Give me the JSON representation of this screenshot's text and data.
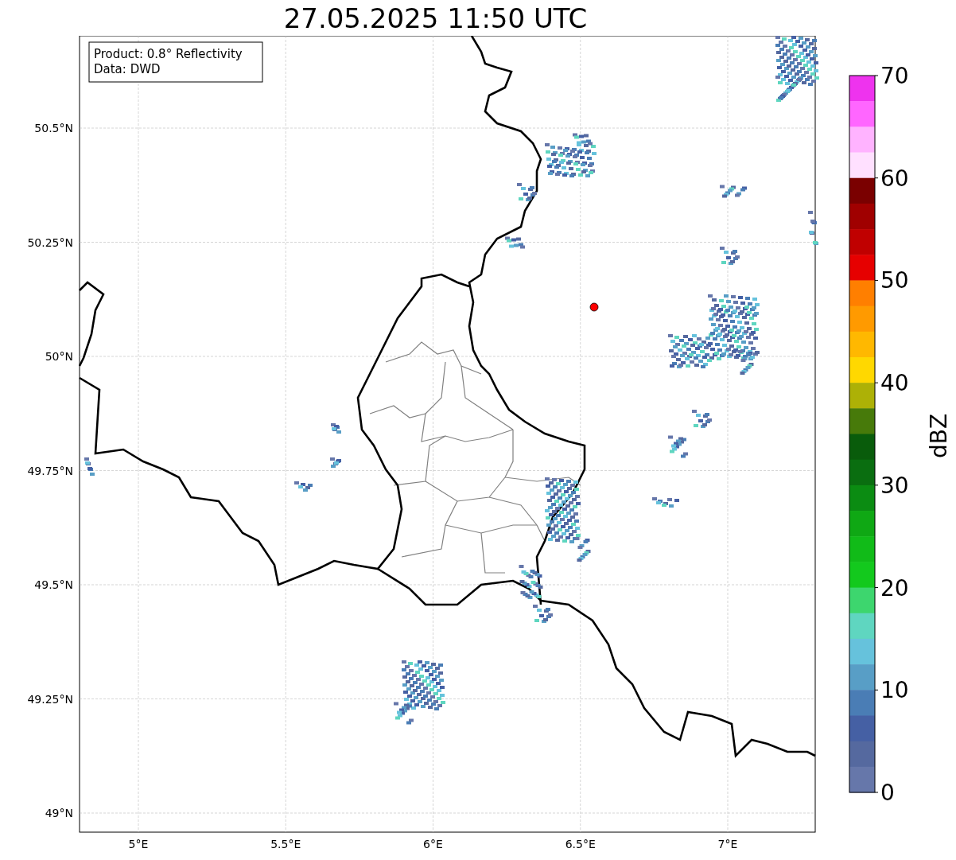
{
  "title": "27.05.2025 11:50 UTC",
  "map": {
    "info_box": [
      "Product: 0.8° Reflectivity",
      "Data: DWD"
    ],
    "lat_ticks": [
      "50.5°N",
      "50.25°N",
      "50°N",
      "49.75°N",
      "49.5°N",
      "49.25°N",
      "49°N"
    ],
    "lon_ticks": [
      "5°E",
      "5.5°E",
      "6°E",
      "6.5°E",
      "7°E"
    ]
  },
  "colorbar": {
    "label": "dBZ",
    "ticks": [
      "70",
      "60",
      "50",
      "40",
      "30",
      "20",
      "10",
      "0"
    ],
    "bands": [
      {
        "color": "#ee33ee"
      },
      {
        "color": "#ff66ff"
      },
      {
        "color": "#ffb3ff"
      },
      {
        "color": "#ffe0ff"
      },
      {
        "color": "#7a0000"
      },
      {
        "color": "#a00000"
      },
      {
        "color": "#c00000"
      },
      {
        "color": "#e60000"
      },
      {
        "color": "#ff7f00"
      },
      {
        "color": "#ff9a00"
      },
      {
        "color": "#ffb800"
      },
      {
        "color": "#ffd800"
      },
      {
        "color": "#adb106"
      },
      {
        "color": "#477a0a"
      },
      {
        "color": "#095c0b"
      },
      {
        "color": "#0a6e10"
      },
      {
        "color": "#0b8c12"
      },
      {
        "color": "#0fa814"
      },
      {
        "color": "#11bb18"
      },
      {
        "color": "#13c91d"
      },
      {
        "color": "#3dd66e"
      },
      {
        "color": "#5fd6c0"
      },
      {
        "color": "#66c2dc"
      },
      {
        "color": "#589ec6"
      },
      {
        "color": "#4a7db5"
      },
      {
        "color": "#4560a4"
      },
      {
        "color": "#55699f"
      },
      {
        "color": "#6677aa"
      }
    ]
  }
}
